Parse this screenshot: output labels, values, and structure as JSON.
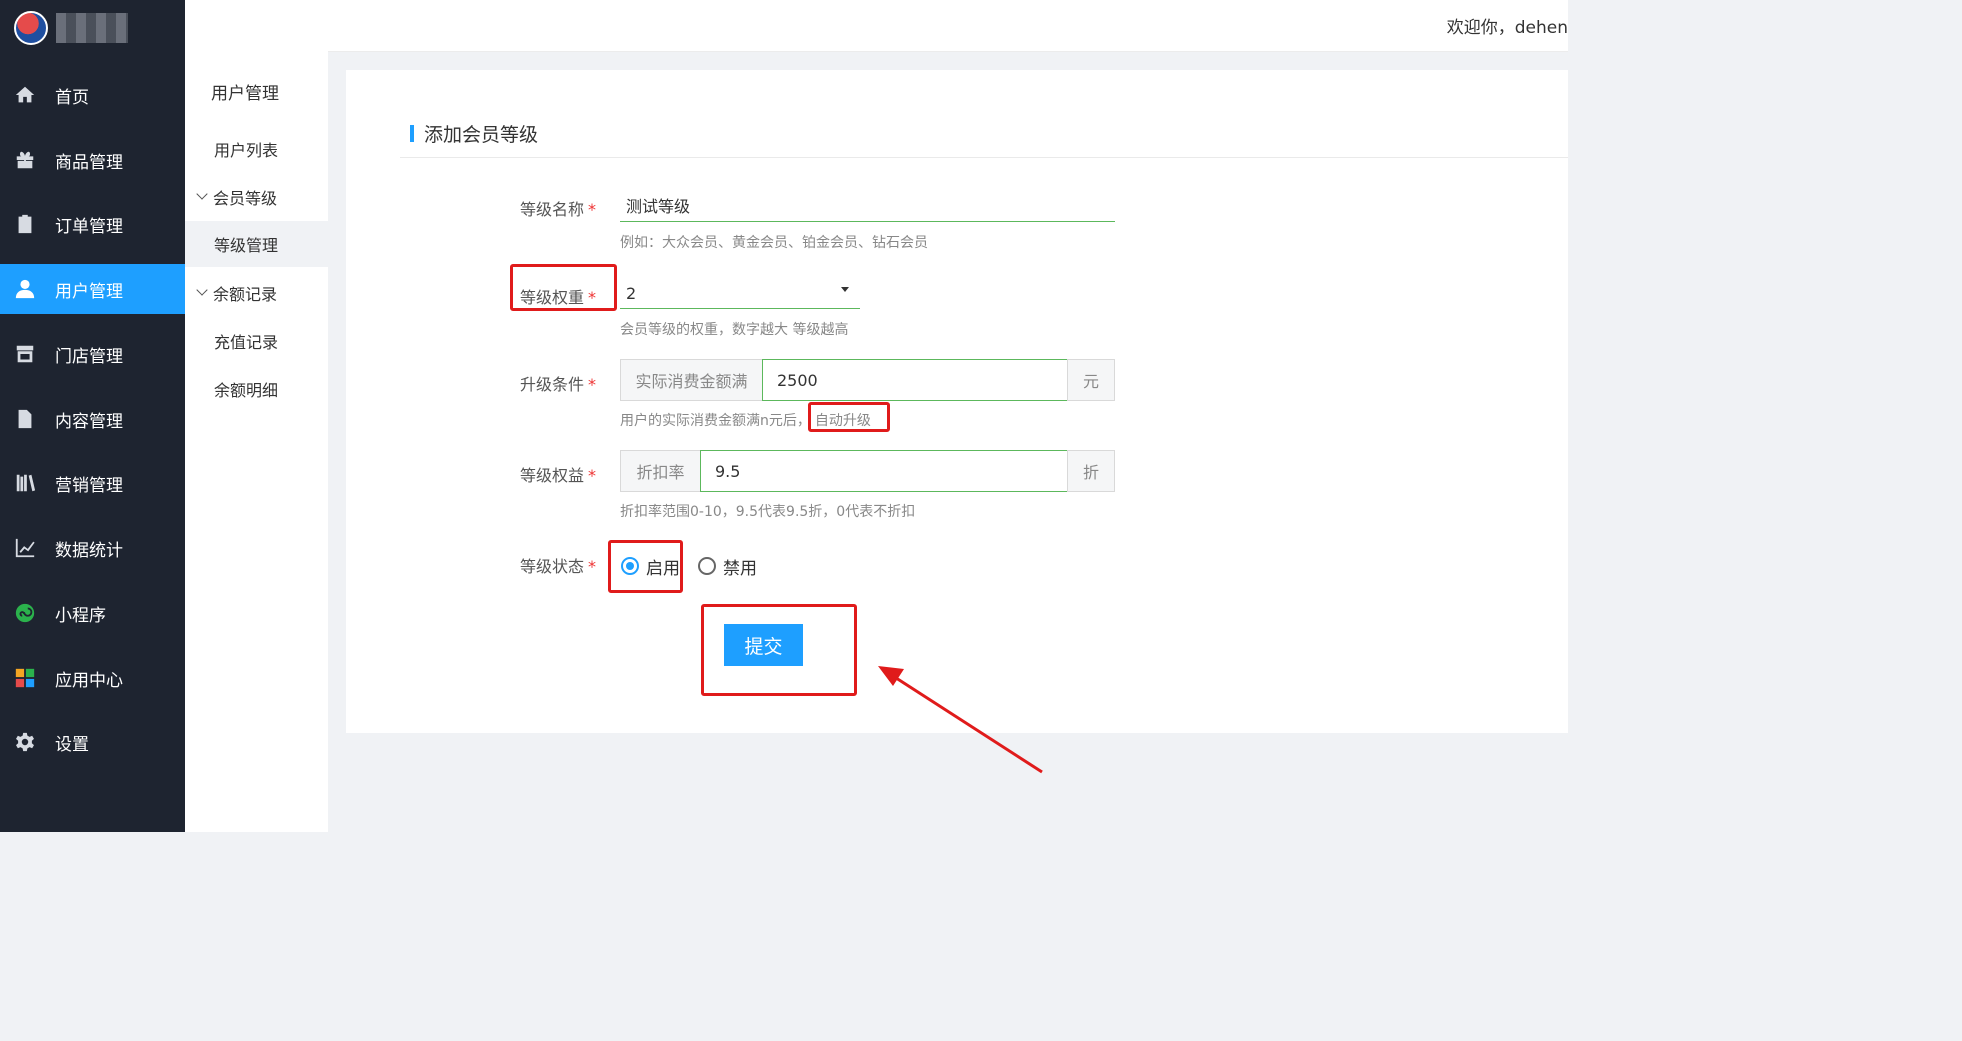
{
  "header": {
    "welcome_text": "欢迎你，dehen"
  },
  "sidebar": {
    "items": [
      {
        "label": "首页",
        "icon": "home-icon"
      },
      {
        "label": "商品管理",
        "icon": "gift-icon"
      },
      {
        "label": "订单管理",
        "icon": "clipboard-icon"
      },
      {
        "label": "用户管理",
        "icon": "user-icon"
      },
      {
        "label": "门店管理",
        "icon": "store-icon"
      },
      {
        "label": "内容管理",
        "icon": "document-icon"
      },
      {
        "label": "营销管理",
        "icon": "books-icon"
      },
      {
        "label": "数据统计",
        "icon": "line-chart-icon"
      },
      {
        "label": "小程序",
        "icon": "miniprogram-icon"
      },
      {
        "label": "应用中心",
        "icon": "apps-icon"
      },
      {
        "label": "设置",
        "icon": "gear-icon"
      }
    ],
    "active_index": 3
  },
  "subnav": {
    "title": "用户管理",
    "items": [
      {
        "label": "用户列表"
      },
      {
        "label": "会员等级"
      },
      {
        "label": "等级管理"
      },
      {
        "label": "余额记录"
      },
      {
        "label": "充值记录"
      },
      {
        "label": "余额明细"
      }
    ]
  },
  "form": {
    "title": "添加会员等级",
    "name": {
      "label": "等级名称",
      "value": "测试等级",
      "hint": "例如：大众会员、黄金会员、铂金会员、钻石会员"
    },
    "weight": {
      "label": "等级权重",
      "value": "2",
      "hint": "会员等级的权重，数字越大 等级越高"
    },
    "upgrade": {
      "label": "升级条件",
      "prefix": "实际消费金额满",
      "value": "2500",
      "suffix": "元",
      "hint": "用户的实际消费金额满n元后，",
      "hint_highlight": "自动升级"
    },
    "benefit": {
      "label": "等级权益",
      "prefix": "折扣率",
      "value": "9.5",
      "suffix": "折",
      "hint": "折扣率范围0-10，9.5代表9.5折，0代表不折扣"
    },
    "status": {
      "label": "等级状态",
      "options": [
        "启用",
        "禁用"
      ],
      "selected": "启用"
    },
    "required_mark": "*",
    "submit_label": "提交"
  },
  "colors": {
    "accent": "#1e9fff",
    "sidebar_bg": "#1e2430",
    "valid_border": "#5cb85c",
    "annotation_red": "#e01b1b"
  }
}
